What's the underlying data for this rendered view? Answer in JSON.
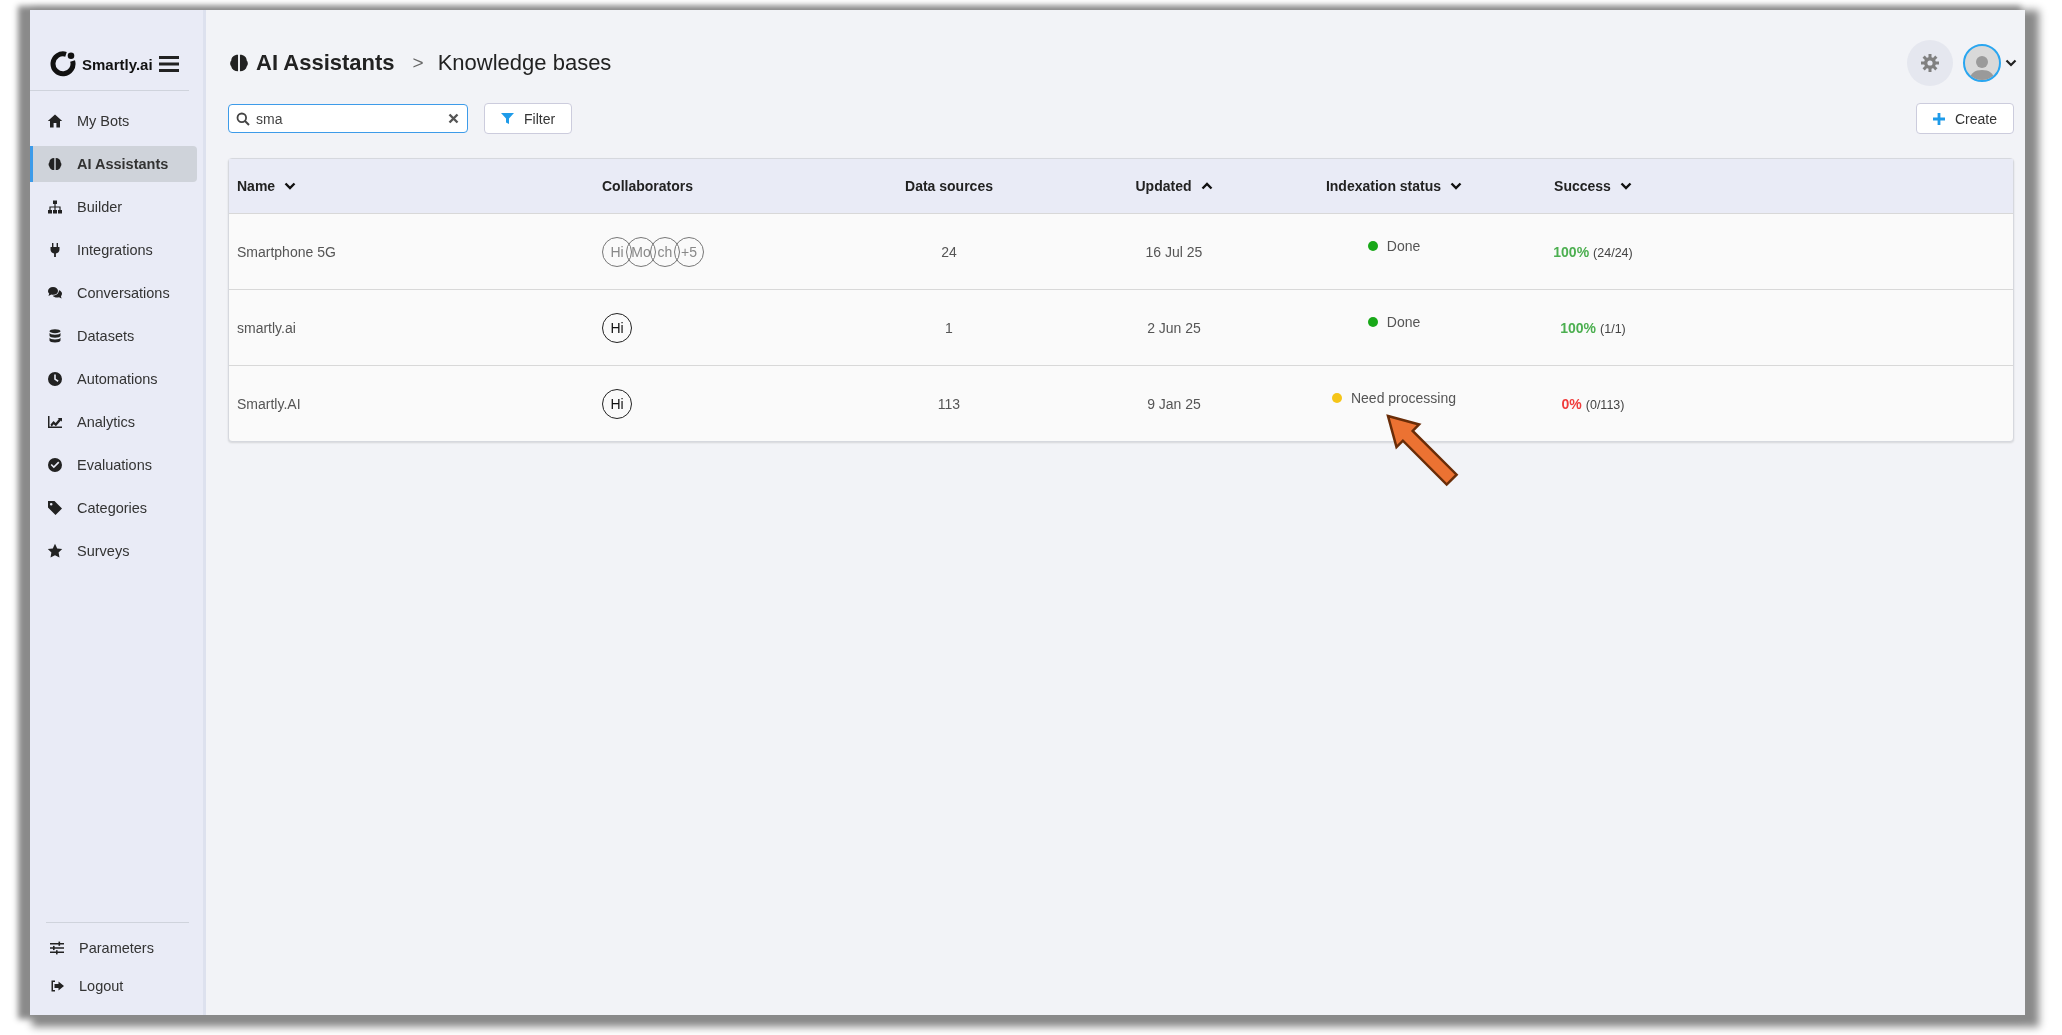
{
  "sidebar": {
    "brand": "Smartly.ai",
    "items": [
      {
        "label": "My Bots",
        "selected": false
      },
      {
        "label": "AI Assistants",
        "selected": true
      },
      {
        "label": "Builder",
        "selected": false
      },
      {
        "label": "Integrations",
        "selected": false
      },
      {
        "label": "Conversations",
        "selected": false
      },
      {
        "label": "Datasets",
        "selected": false
      },
      {
        "label": "Automations",
        "selected": false
      },
      {
        "label": "Analytics",
        "selected": false
      },
      {
        "label": "Evaluations",
        "selected": false
      },
      {
        "label": "Categories",
        "selected": false
      },
      {
        "label": "Surveys",
        "selected": false
      }
    ],
    "footer_items": [
      {
        "label": "Parameters"
      },
      {
        "label": "Logout"
      }
    ]
  },
  "breadcrumb": {
    "section": "AI Assistants",
    "separator": ">",
    "page": "Knowledge bases"
  },
  "search": {
    "value": "sma"
  },
  "filter_button": "Filter",
  "create_button": "Create",
  "table": {
    "columns": [
      {
        "label": "Name",
        "sorted": true,
        "ascending": false
      },
      {
        "label": "Collaborators",
        "sorted": false
      },
      {
        "label": "Data sources",
        "sorted": false
      },
      {
        "label": "Updated",
        "sorted": true,
        "ascending": true
      },
      {
        "label": "Indexation status",
        "sorted": true,
        "ascending": false
      },
      {
        "label": "Success",
        "sorted": true,
        "ascending": false
      }
    ],
    "rows": [
      {
        "name": "Smartphone 5G",
        "collaborators": [
          {
            "initials": "Hi",
            "dimmed": true
          },
          {
            "initials": "Mo",
            "dimmed": true
          },
          {
            "initials": "ch",
            "dimmed": true
          },
          {
            "initials": "+5",
            "dimmed": true
          }
        ],
        "data_sources": "24",
        "updated": "16 Jul 25",
        "status": {
          "label": "Done",
          "color": "#18a818"
        },
        "success": {
          "percent": "100%",
          "color": "#4caf50",
          "count": "(24/24)"
        }
      },
      {
        "name": "smartly.ai",
        "collaborators": [
          {
            "initials": "Hi",
            "dimmed": false
          }
        ],
        "data_sources": "1",
        "updated": "2 Jun 25",
        "status": {
          "label": "Done",
          "color": "#18a818"
        },
        "success": {
          "percent": "100%",
          "color": "#4caf50",
          "count": "(1/1)"
        }
      },
      {
        "name": "Smartly.AI",
        "collaborators": [
          {
            "initials": "Hi",
            "dimmed": false
          }
        ],
        "data_sources": "113",
        "updated": "9 Jan 25",
        "status": {
          "label": "Need processing",
          "color": "#f5c518"
        },
        "success": {
          "percent": "0%",
          "color": "#f03c3c",
          "count": "(0/113)"
        }
      }
    ]
  }
}
